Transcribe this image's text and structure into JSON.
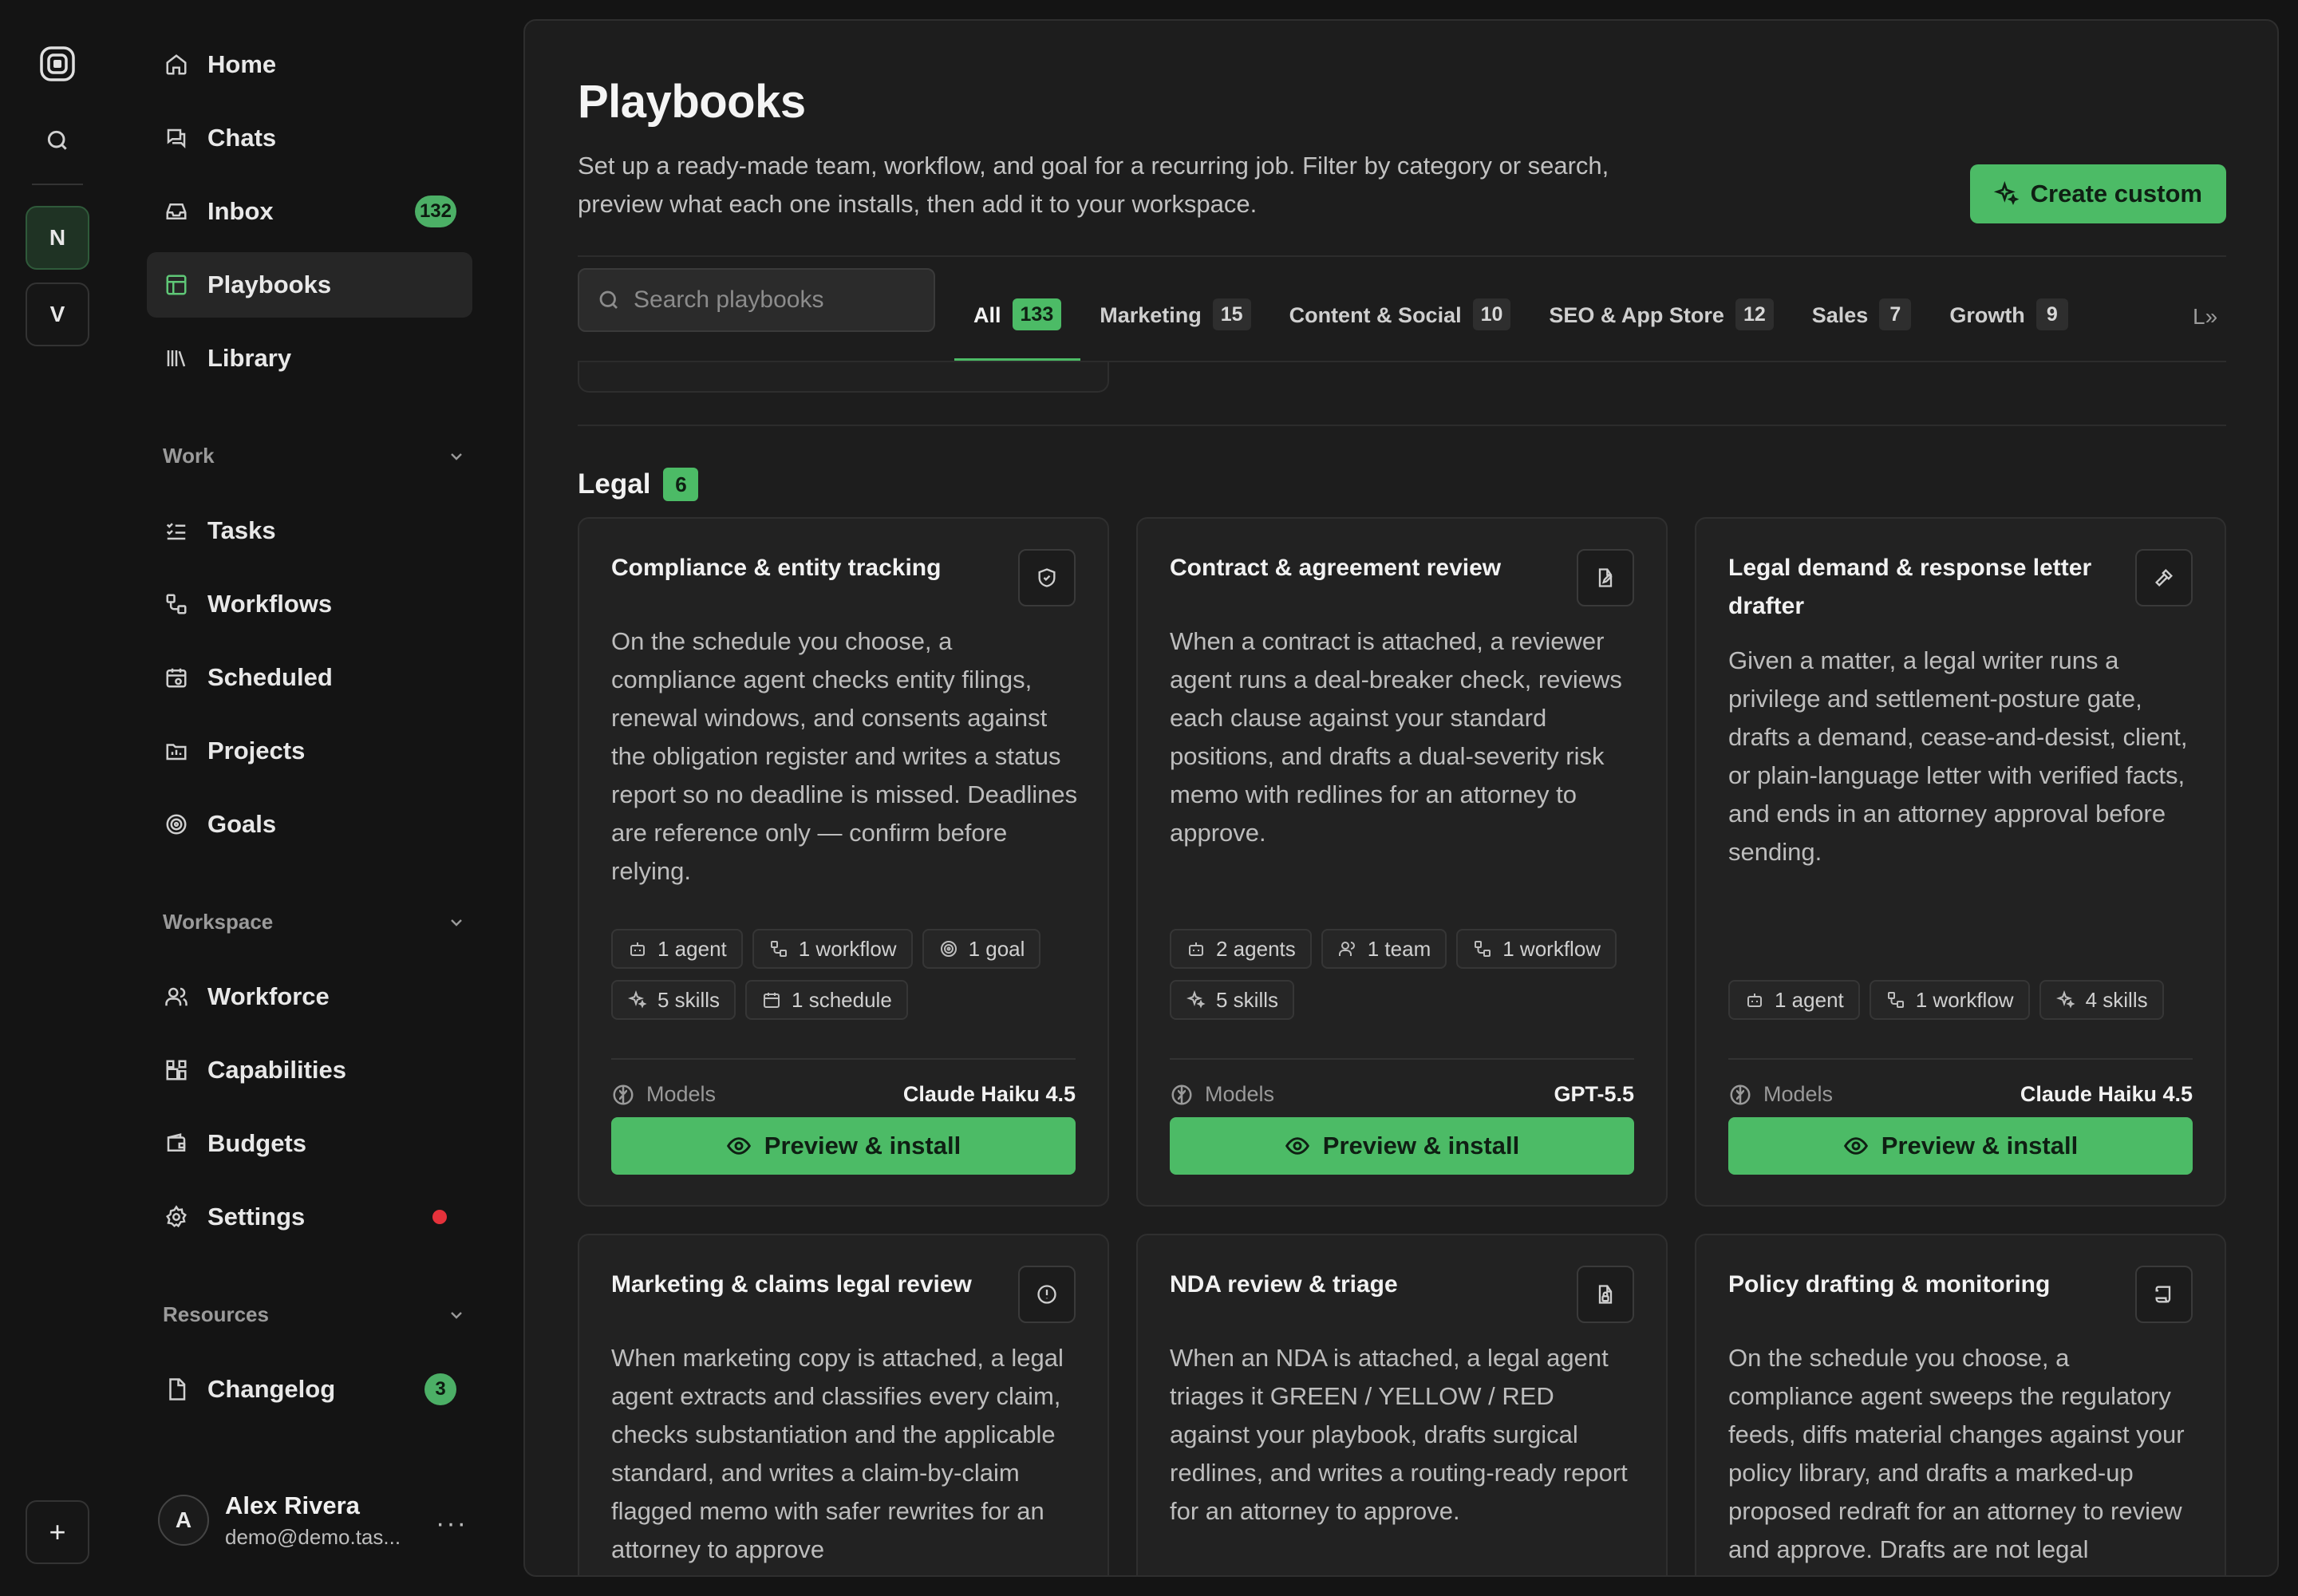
{
  "rail": {
    "workspaces": [
      {
        "letter": "N"
      },
      {
        "letter": "V"
      }
    ],
    "add_label": "+"
  },
  "sidebar": {
    "main_items": [
      {
        "label": "Home",
        "icon": "home-icon"
      },
      {
        "label": "Chats",
        "icon": "chat-icon"
      },
      {
        "label": "Inbox",
        "icon": "inbox-icon",
        "badge": "132"
      },
      {
        "label": "Playbooks",
        "icon": "playbooks-icon",
        "active": true
      },
      {
        "label": "Library",
        "icon": "library-icon"
      }
    ],
    "work_label": "Work",
    "work_items": [
      {
        "label": "Tasks",
        "icon": "tasks-icon"
      },
      {
        "label": "Workflows",
        "icon": "workflow-icon"
      },
      {
        "label": "Scheduled",
        "icon": "calendar-icon"
      },
      {
        "label": "Projects",
        "icon": "projects-icon"
      },
      {
        "label": "Goals",
        "icon": "target-icon"
      }
    ],
    "workspace_label": "Workspace",
    "workspace_items": [
      {
        "label": "Workforce",
        "icon": "users-icon"
      },
      {
        "label": "Capabilities",
        "icon": "blocks-icon"
      },
      {
        "label": "Budgets",
        "icon": "wallet-icon"
      },
      {
        "label": "Settings",
        "icon": "gear-icon",
        "dot_color": "#e5323b"
      }
    ],
    "resources_label": "Resources",
    "resources_items": [
      {
        "label": "Changelog",
        "icon": "file-icon",
        "badge": "3"
      }
    ],
    "user": {
      "initial": "A",
      "name": "Alex Rivera",
      "email": "demo@demo.tas...",
      "more": "···"
    }
  },
  "main": {
    "title": "Playbooks",
    "description": "Set up a ready-made team, workflow, and goal for a recurring job. Filter by category or search, preview what each one installs, then add it to your workspace.",
    "create_button": "Create custom",
    "search_placeholder": "Search playbooks",
    "tabs": [
      {
        "label": "All",
        "count": "133",
        "active": true
      },
      {
        "label": "Marketing",
        "count": "15"
      },
      {
        "label": "Content & Social",
        "count": "10"
      },
      {
        "label": "SEO & App Store",
        "count": "12"
      },
      {
        "label": "Sales",
        "count": "7"
      },
      {
        "label": "Growth",
        "count": "9"
      }
    ],
    "tabs_more": "L»",
    "section": {
      "title": "Legal",
      "count": "6"
    },
    "models_label": "Models",
    "install_label": "Preview & install",
    "cards": [
      {
        "title": "Compliance & entity tracking",
        "icon": "shield-icon",
        "description": "On the schedule you choose, a compliance agent checks entity filings, renewal windows, and consents against the obligation register and writes a status report so no deadline is missed. Deadlines are reference only — confirm before relying.",
        "chips": [
          {
            "label": "1 agent",
            "icon": "bot-icon"
          },
          {
            "label": "1 workflow",
            "icon": "workflow-icon"
          },
          {
            "label": "1 goal",
            "icon": "target-icon"
          },
          {
            "label": "5 skills",
            "icon": "sparkle-icon"
          },
          {
            "label": "1 schedule",
            "icon": "calendar-icon"
          }
        ],
        "model": "Claude Haiku 4.5"
      },
      {
        "title": "Contract & agreement review",
        "icon": "file-edit-icon",
        "description": "When a contract is attached, a reviewer agent runs a deal-breaker check, reviews each clause against your standard positions, and drafts a dual-severity risk memo with redlines for an attorney to approve.",
        "chips": [
          {
            "label": "2 agents",
            "icon": "bot-icon"
          },
          {
            "label": "1 team",
            "icon": "users-icon"
          },
          {
            "label": "1 workflow",
            "icon": "workflow-icon"
          },
          {
            "label": "5 skills",
            "icon": "sparkle-icon"
          }
        ],
        "model": "GPT-5.5"
      },
      {
        "title": "Legal demand & response letter drafter",
        "icon": "gavel-icon",
        "description": "Given a matter, a legal writer runs a privilege and settlement-posture gate, drafts a demand, cease-and-desist, client, or plain-language letter with verified facts, and ends in an attorney approval before sending.",
        "chips": [
          {
            "label": "1 agent",
            "icon": "bot-icon"
          },
          {
            "label": "1 workflow",
            "icon": "workflow-icon"
          },
          {
            "label": "4 skills",
            "icon": "sparkle-icon"
          }
        ],
        "model": "Claude Haiku 4.5"
      },
      {
        "title": "Marketing & claims legal review",
        "icon": "alert-circle-icon",
        "description": "When marketing copy is attached, a legal agent extracts and classifies every claim, checks substantiation and the applicable standard, and writes a claim-by-claim flagged memo with safer rewrites for an attorney to approve"
      },
      {
        "title": "NDA review & triage",
        "icon": "file-lock-icon",
        "description": "When an NDA is attached, a legal agent triages it GREEN / YELLOW / RED against your playbook, drafts surgical redlines, and writes a routing-ready report for an attorney to approve."
      },
      {
        "title": "Policy drafting & monitoring",
        "icon": "scroll-icon",
        "description": "On the schedule you choose, a compliance agent sweeps the regulatory feeds, diffs material changes against your policy library, and drafts a marked-up proposed redraft for an attorney to review and approve. Drafts are not legal"
      }
    ]
  },
  "colors": {
    "accent": "#4cbb66",
    "background": "#141414",
    "panel": "#1d1d1d",
    "card": "#222222",
    "alert": "#e5323b"
  }
}
